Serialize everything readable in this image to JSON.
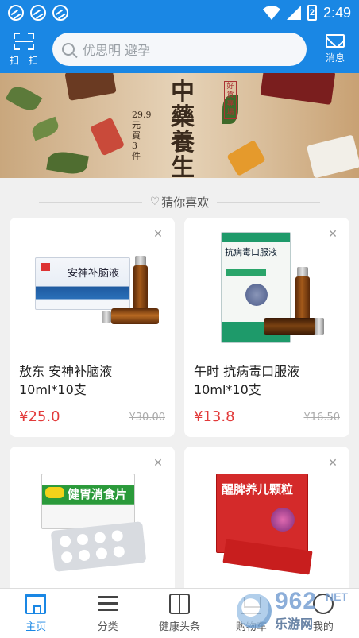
{
  "status_bar": {
    "time": "2:49",
    "battery": "2"
  },
  "header": {
    "scan_label": "扫一扫",
    "search_placeholder": "优思明 避孕",
    "messages_label": "消息"
  },
  "banner": {
    "title": "中藥養生",
    "side_text": "29.9元買3件",
    "seal_text": "好貨專場"
  },
  "section": {
    "title": "猜你喜欢"
  },
  "products": [
    {
      "name": "敖东 安神补脑液 10ml*10支",
      "price": "¥25.0",
      "original_price": "¥30.00",
      "package_label": "安神补脑液"
    },
    {
      "name": "午时 抗病毒口服液 10ml*10支",
      "price": "¥13.8",
      "original_price": "¥16.50",
      "package_label": "抗病毒口服液"
    },
    {
      "name": "",
      "price": "",
      "original_price": "",
      "package_label": "健胃消食片"
    },
    {
      "name": "",
      "price": "",
      "original_price": "",
      "package_label": "醒脾养儿颗粒"
    }
  ],
  "bottom_nav": [
    {
      "label": "主页",
      "icon": "home-icon",
      "active": true
    },
    {
      "label": "分类",
      "icon": "list-icon",
      "active": false
    },
    {
      "label": "健康头条",
      "icon": "book-icon",
      "active": false
    },
    {
      "label": "购物车",
      "icon": "cart-icon",
      "active": false
    },
    {
      "label": "我的",
      "icon": "user-icon",
      "active": false
    }
  ],
  "watermark": {
    "number": "962",
    "net": "NET",
    "site": "乐游网"
  },
  "colors": {
    "primary": "#1a87e4",
    "price": "#e23a3a"
  }
}
